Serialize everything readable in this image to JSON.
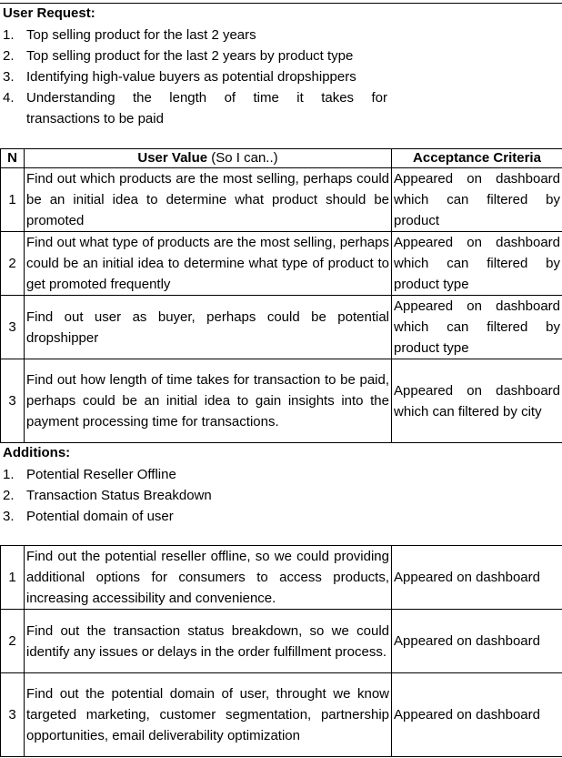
{
  "user_request": {
    "heading": "User Request:",
    "items": [
      {
        "num": "1.",
        "text": "Top selling product for the last 2 years"
      },
      {
        "num": "2.",
        "text": "Top selling product for the last 2 years by product type"
      },
      {
        "num": "3.",
        "text": "Identifying high-value buyers as potential dropshippers"
      },
      {
        "num": "4.",
        "text": "Understanding the length of time it takes for",
        "cont": "transactions to be paid"
      }
    ]
  },
  "table1": {
    "col_n": "N",
    "col_value": "User Value",
    "col_value_suffix": " (So I can..)",
    "col_criteria": "Acceptance Criteria",
    "rows": [
      {
        "n": "1",
        "value": "Find out which products are the most selling, perhaps could be an initial idea to determine what product should be promoted",
        "criteria": "Appeared on dashboard which can filtered by product"
      },
      {
        "n": "2",
        "value": "Find out what type of products are the most selling, perhaps could be an initial idea to determine what type of product to get promoted frequently",
        "criteria": "Appeared on dashboard which can filtered by product type"
      },
      {
        "n": "3",
        "value": "Find out user as buyer, perhaps could be potential dropshipper",
        "criteria": "Appeared on dashboard which can filtered by product type"
      },
      {
        "n": "3",
        "value": "Find out how length of time takes for transaction to be paid, perhaps could be an initial idea to gain insights into the payment processing time for transactions.",
        "criteria": "Appeared on dashboard which can filtered by city"
      }
    ]
  },
  "additions": {
    "heading": "Additions:",
    "items": [
      {
        "num": "1.",
        "text": "Potential Reseller Offline"
      },
      {
        "num": "2.",
        "text": "Transaction Status Breakdown"
      },
      {
        "num": "3.",
        "text": "Potential domain of user"
      }
    ]
  },
  "table2": {
    "rows": [
      {
        "n": "1",
        "value": "Find out the potential reseller offline, so we could providing additional options for consumers to access products, increasing accessibility and convenience.",
        "criteria": "Appeared on dashboard"
      },
      {
        "n": "2",
        "value": "Find out the transaction status breakdown, so we could identify any issues or delays in the order fulfillment process.",
        "criteria": "Appeared on dashboard"
      },
      {
        "n": "3",
        "value": "Find out the potential domain of user, throught we know targeted marketing, customer segmentation, partnership opportunities, email deliverability optimization",
        "criteria": "Appeared on dashboard"
      }
    ]
  }
}
